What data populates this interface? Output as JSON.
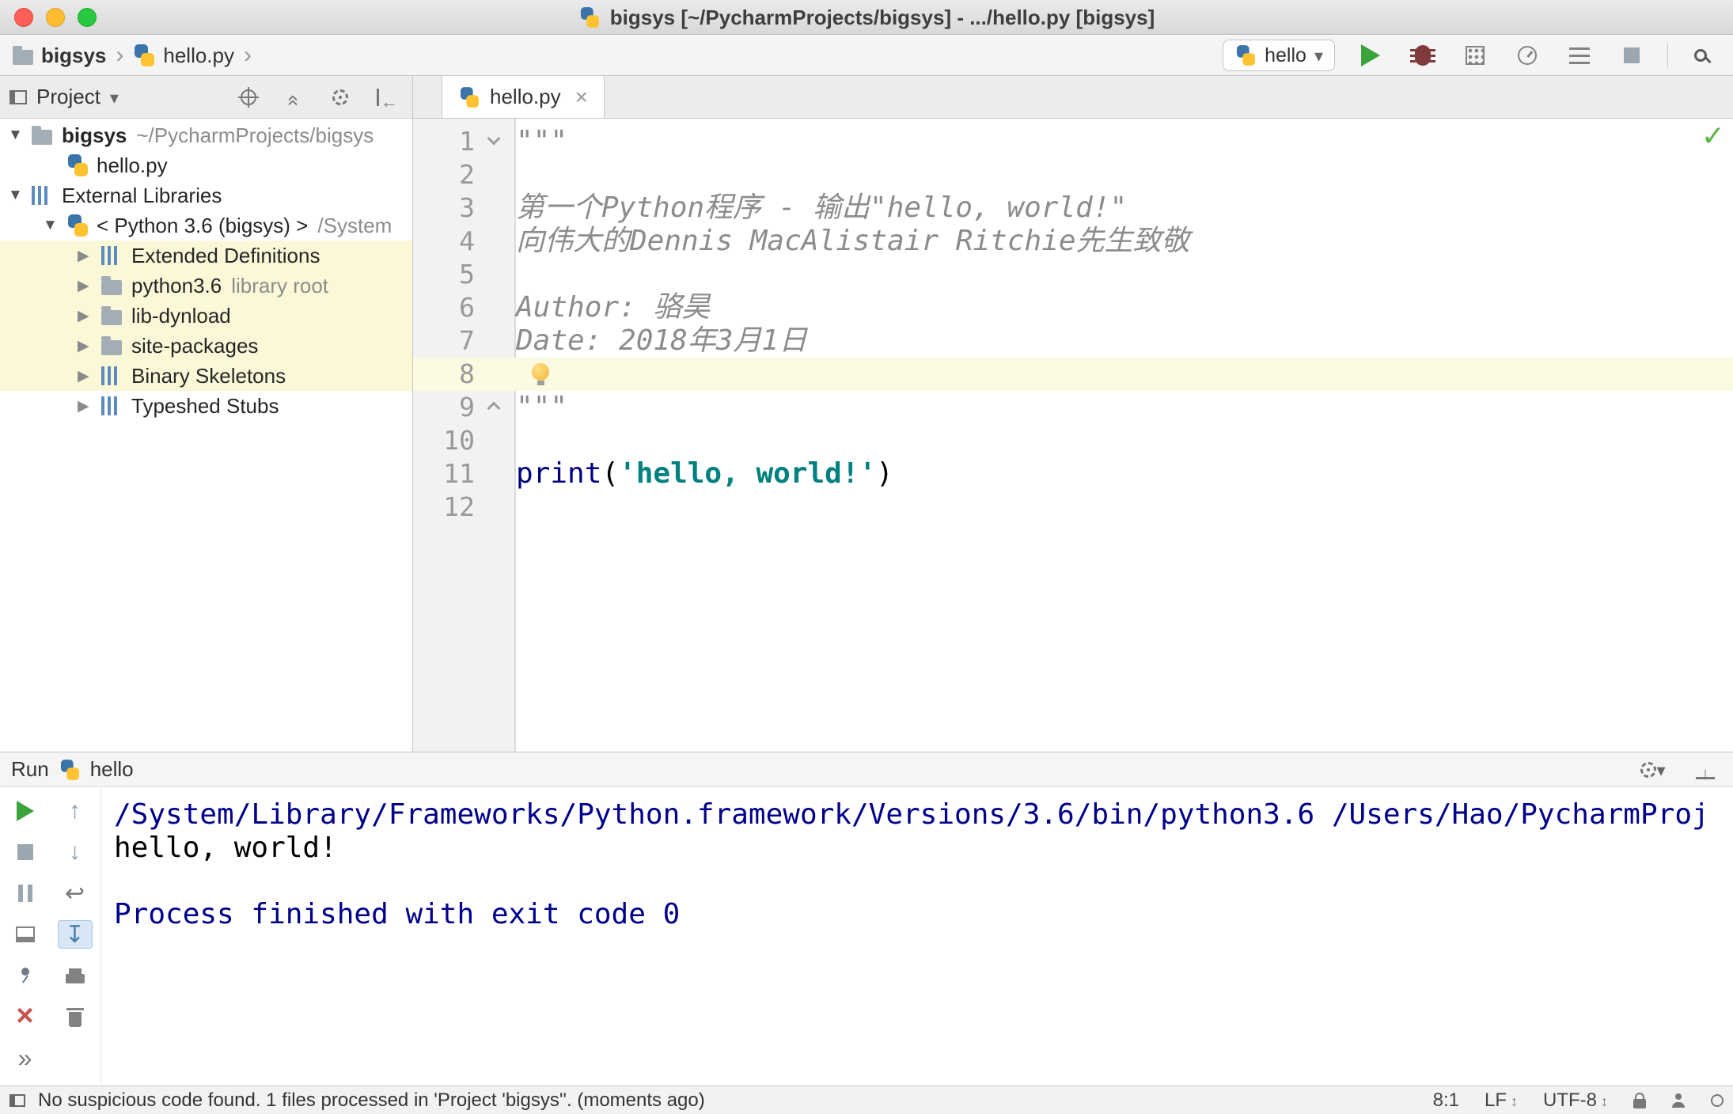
{
  "window": {
    "title": "bigsys [~/PycharmProjects/bigsys] - .../hello.py [bigsys]"
  },
  "icons": {
    "check": "✓",
    "chevron": "›",
    "caret": "▾",
    "expanded": "▼",
    "collapsed": "▶"
  },
  "navbar": {
    "breadcrumb": [
      {
        "label": "bigsys",
        "icon": "folder",
        "bold": true
      },
      {
        "label": "hello.py",
        "icon": "python-file",
        "bold": false
      }
    ],
    "run_config": {
      "label": "hello"
    },
    "actions": [
      {
        "name": "run-button",
        "icon": "runbig"
      },
      {
        "name": "debug-button",
        "icon": "debug"
      },
      {
        "name": "coverage-button",
        "icon": "cov"
      },
      {
        "name": "profiler-button",
        "icon": "prof"
      },
      {
        "name": "reformat-button",
        "icon": "fmt"
      },
      {
        "name": "stop-button",
        "icon": "stopnav"
      }
    ]
  },
  "project": {
    "header": {
      "title": "Project"
    },
    "header_actions": [
      {
        "name": "locate-file-button",
        "icon": "locate"
      },
      {
        "name": "collapse-all-button",
        "icon": "collapse"
      },
      {
        "name": "project-settings-button",
        "icon": "gear"
      },
      {
        "name": "hide-panel-button",
        "icon": "hideleft"
      }
    ],
    "tree": [
      {
        "label": "bigsys",
        "suffix": "~/PycharmProjects/bigsys",
        "icon": "folder",
        "arrow": "expanded",
        "level": 0,
        "bold": true,
        "highlight": false
      },
      {
        "label": "hello.py",
        "suffix": "",
        "icon": "python-file",
        "arrow": "none",
        "level": 1,
        "bold": false,
        "highlight": false
      },
      {
        "label": "External Libraries",
        "suffix": "",
        "icon": "library",
        "arrow": "expanded",
        "level": 0,
        "bold": false,
        "highlight": false
      },
      {
        "label": "< Python 3.6 (bigsys) >",
        "suffix": "/System",
        "icon": "python",
        "arrow": "expanded",
        "level": 1,
        "bold": false,
        "highlight": false
      },
      {
        "label": "Extended Definitions",
        "suffix": "",
        "icon": "library",
        "arrow": "collapsed",
        "level": 2,
        "bold": false,
        "highlight": true
      },
      {
        "label": "python3.6",
        "suffix": "library root",
        "icon": "folder",
        "arrow": "collapsed",
        "level": 2,
        "bold": false,
        "highlight": true
      },
      {
        "label": "lib-dynload",
        "suffix": "",
        "icon": "folder",
        "arrow": "collapsed",
        "level": 2,
        "bold": false,
        "highlight": true
      },
      {
        "label": "site-packages",
        "suffix": "",
        "icon": "folder",
        "arrow": "collapsed",
        "level": 2,
        "bold": false,
        "highlight": true
      },
      {
        "label": "Binary Skeletons",
        "suffix": "",
        "icon": "library",
        "arrow": "collapsed",
        "level": 2,
        "bold": false,
        "highlight": true
      },
      {
        "label": "Typeshed Stubs",
        "suffix": "",
        "icon": "library",
        "arrow": "collapsed",
        "level": 2,
        "bold": false,
        "highlight": false
      }
    ]
  },
  "editor": {
    "tab": {
      "label": "hello.py"
    },
    "lines": [
      {
        "num": 1,
        "tokens": [
          {
            "text": "\"\"\"",
            "style": "docstring"
          }
        ],
        "fold": "start",
        "current": false,
        "bulb": false
      },
      {
        "num": 2,
        "tokens": [],
        "fold": "",
        "current": false,
        "bulb": false
      },
      {
        "num": 3,
        "tokens": [
          {
            "text": "第一个Python程序 - 输出\"hello, world!\"",
            "style": "docstring"
          }
        ],
        "fold": "",
        "current": false,
        "bulb": false
      },
      {
        "num": 4,
        "tokens": [
          {
            "text": "向伟大的Dennis MacAlistair Ritchie先生致敬",
            "style": "docstring"
          }
        ],
        "fold": "",
        "current": false,
        "bulb": false
      },
      {
        "num": 5,
        "tokens": [],
        "fold": "",
        "current": false,
        "bulb": false
      },
      {
        "num": 6,
        "tokens": [
          {
            "text": "Author: 骆昊",
            "style": "docstring"
          }
        ],
        "fold": "",
        "current": false,
        "bulb": false
      },
      {
        "num": 7,
        "tokens": [
          {
            "text": "Date: 2018年3月1日",
            "style": "docstring"
          }
        ],
        "fold": "",
        "current": false,
        "bulb": false
      },
      {
        "num": 8,
        "tokens": [],
        "fold": "",
        "current": true,
        "bulb": true
      },
      {
        "num": 9,
        "tokens": [
          {
            "text": "\"\"\"",
            "style": "docstring"
          }
        ],
        "fold": "end",
        "current": false,
        "bulb": false
      },
      {
        "num": 10,
        "tokens": [],
        "fold": "",
        "current": false,
        "bulb": false
      },
      {
        "num": 11,
        "tokens": [
          {
            "text": "print",
            "style": "keyword"
          },
          {
            "text": "(",
            "style": "plain"
          },
          {
            "text": "'hello, world!'",
            "style": "string"
          },
          {
            "text": ")",
            "style": "plain"
          }
        ],
        "fold": "",
        "current": false,
        "bulb": false
      },
      {
        "num": 12,
        "tokens": [],
        "fold": "",
        "current": false,
        "bulb": false
      }
    ]
  },
  "run": {
    "title": "Run",
    "config": "hello",
    "header_actions": [
      {
        "name": "run-settings-button",
        "icon": "gear"
      },
      {
        "name": "hide-run-panel-button",
        "icon": "hidedown"
      }
    ],
    "toolbar": {
      "col1": [
        {
          "name": "rerun-button",
          "icon": "rerun",
          "selected": false
        },
        {
          "name": "stop-button",
          "icon": "stopg",
          "selected": false
        },
        {
          "name": "pause-output-button",
          "icon": "pause",
          "selected": false
        },
        {
          "name": "restore-layout-button",
          "icon": "layout",
          "selected": false
        },
        {
          "name": "pin-tab-button",
          "icon": "pin",
          "selected": false
        },
        {
          "name": "close-tab-button",
          "icon": "closex",
          "selected": false
        },
        {
          "name": "show-more-button",
          "icon": "more",
          "selected": false
        }
      ],
      "col2": [
        {
          "name": "up-stacktrace-button",
          "icon": "arrup",
          "selected": false
        },
        {
          "name": "down-stacktrace-button",
          "icon": "arrdn",
          "selected": false
        },
        {
          "name": "soft-wrap-button",
          "icon": "wrap",
          "selected": false
        },
        {
          "name": "scroll-to-end-button",
          "icon": "scrend",
          "selected": true
        },
        {
          "name": "print-button",
          "icon": "print",
          "selected": false
        },
        {
          "name": "clear-all-button",
          "icon": "trash",
          "selected": false
        }
      ]
    },
    "output": [
      {
        "text": "/System/Library/Frameworks/Python.framework/Versions/3.6/bin/python3.6 /Users/Hao/PycharmProj",
        "style": "system"
      },
      {
        "text": "hello, world!",
        "style": "stdout"
      },
      {
        "text": "",
        "style": "stdout"
      },
      {
        "text": "Process finished with exit code 0",
        "style": "system"
      }
    ]
  },
  "statusbar": {
    "message": "No suspicious code found. 1 files processed in 'Project 'bigsys''. (moments ago)",
    "caret": "8:1",
    "line_separator": "LF",
    "encoding": "UTF-8"
  }
}
